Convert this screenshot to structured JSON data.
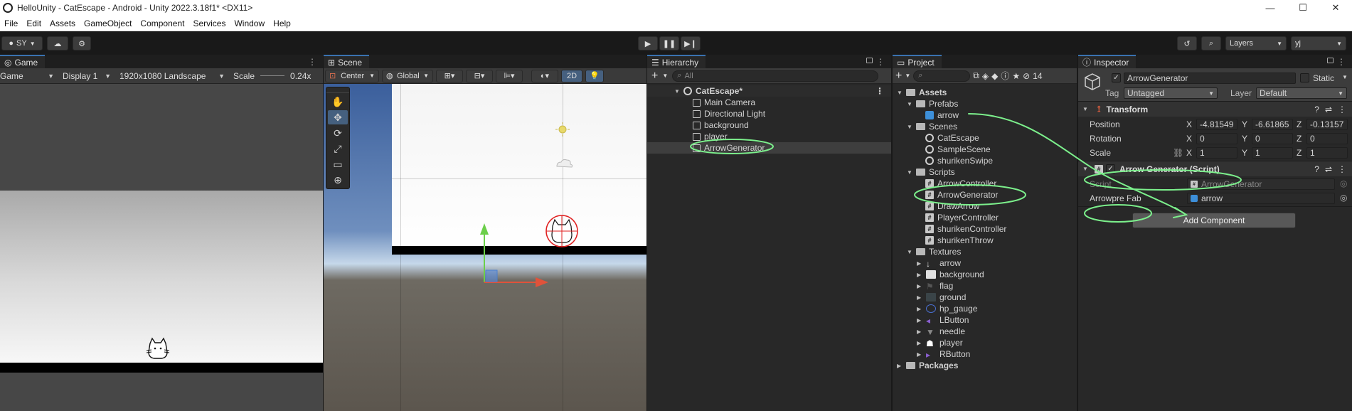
{
  "window": {
    "title": "HelloUnity - CatEscape - Android - Unity 2022.3.18f1* <DX11>",
    "minimize": "—",
    "maximize": "☐",
    "close": "✕"
  },
  "menu": [
    "File",
    "Edit",
    "Assets",
    "GameObject",
    "Component",
    "Services",
    "Window",
    "Help"
  ],
  "toolbar": {
    "account": "SY",
    "layers": "Layers",
    "layout": "yj"
  },
  "game": {
    "tab": "Game",
    "mode": "Game",
    "display": "Display 1",
    "resolution": "1920x1080 Landscape",
    "scale_label": "Scale",
    "scale_value": "0.24x"
  },
  "scene": {
    "tab": "Scene",
    "pivot": "Center",
    "space": "Global",
    "mode2d": "2D"
  },
  "hierarchy": {
    "tab": "Hierarchy",
    "search_placeholder": "All",
    "scene_name": "CatEscape*",
    "items": [
      "Main Camera",
      "Directional Light",
      "background",
      "player",
      "ArrowGenerator"
    ]
  },
  "project": {
    "tab": "Project",
    "hidden_count": "14",
    "root": "Assets",
    "folders": [
      {
        "name": "Prefabs",
        "items": [
          "arrow"
        ]
      },
      {
        "name": "Scenes",
        "items": [
          "CatEscape",
          "SampleScene",
          "shurikenSwipe"
        ]
      },
      {
        "name": "Scripts",
        "items": [
          "ArrowController",
          "ArrowGenerator",
          "DrawArrow",
          "PlayerController",
          "shurikenController",
          "shurikenThrow"
        ]
      },
      {
        "name": "Textures",
        "items": [
          "arrow",
          "background",
          "flag",
          "ground",
          "hp_gauge",
          "LButton",
          "needle",
          "player",
          "RButton"
        ]
      }
    ],
    "packages": "Packages"
  },
  "inspector": {
    "tab": "Inspector",
    "object_name": "ArrowGenerator",
    "static_label": "Static",
    "tag_label": "Tag",
    "tag_value": "Untagged",
    "layer_label": "Layer",
    "layer_value": "Default",
    "transform": {
      "title": "Transform",
      "position_label": "Position",
      "rotation_label": "Rotation",
      "scale_label": "Scale",
      "position": {
        "x": "-4.81549",
        "y": "-6.61865",
        "z": "-0.13157"
      },
      "rotation": {
        "x": "0",
        "y": "0",
        "z": "0"
      },
      "scale": {
        "x": "1",
        "y": "1",
        "z": "1"
      },
      "axis_x": "X",
      "axis_y": "Y",
      "axis_z": "Z"
    },
    "script_component": {
      "title": "Arrow Generator (Script)",
      "script_label": "Script",
      "script_value": "ArrowGenerator",
      "field_label": "Arrowpre Fab",
      "field_value": "arrow"
    },
    "add_component": "Add Component"
  },
  "colors": {
    "annotation": "#7cf08c",
    "accent": "#3a72b0"
  }
}
